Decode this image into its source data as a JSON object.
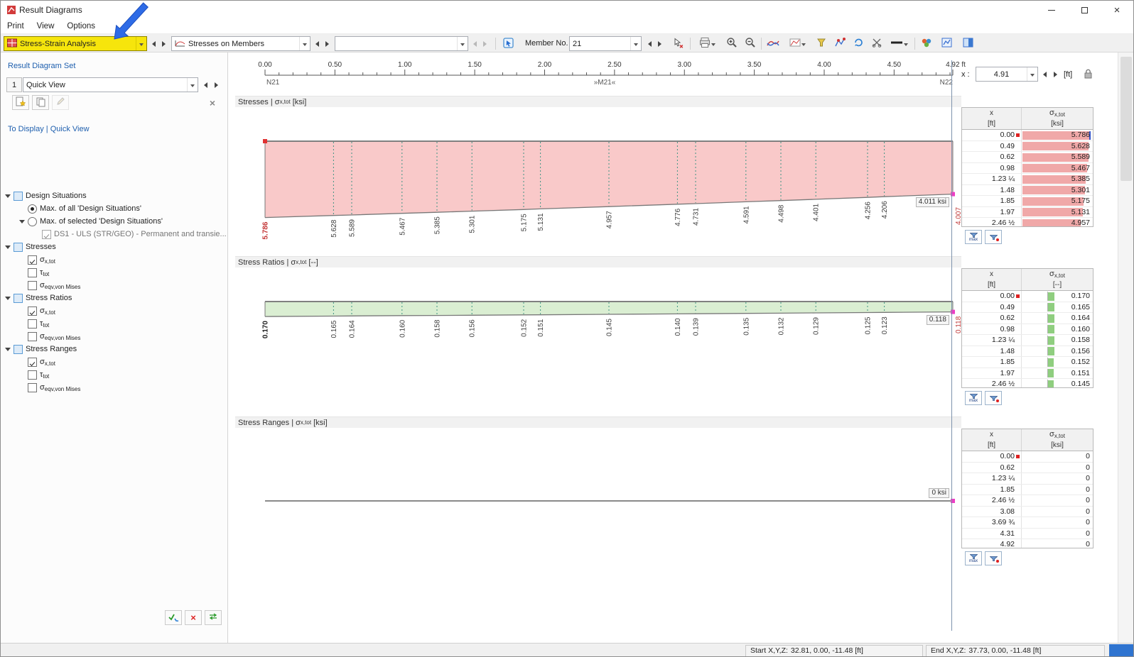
{
  "window": {
    "title": "Result Diagrams"
  },
  "menu": {
    "items": [
      "Print",
      "View",
      "Options"
    ]
  },
  "toolbar": {
    "analysis_combo": "Stress-Strain Analysis",
    "results_combo": "Stresses on Members",
    "empty_combo": "",
    "member_label": "Member No.",
    "member_value": "21"
  },
  "sidebar": {
    "set_section_title": "Result Diagram Set",
    "set_number": "1",
    "set_name": "Quick View",
    "display_section_title": "To Display | Quick View",
    "tree": [
      {
        "level": 0,
        "arrow": true,
        "control": "checkbox",
        "state": "parent",
        "text": "Design Situations"
      },
      {
        "level": 1,
        "arrow": false,
        "control": "radio",
        "state": "selected",
        "text": "Max. of all 'Design Situations'"
      },
      {
        "level": 1,
        "arrow": true,
        "control": "radio",
        "state": "unselected",
        "text": "Max. of selected 'Design Situations'"
      },
      {
        "level": 2,
        "arrow": false,
        "control": "checkbox",
        "state": "checked-disabled",
        "text": "DS1 - ULS (STR/GEO) - Permanent and transie..."
      },
      {
        "level": 0,
        "arrow": true,
        "control": "checkbox",
        "state": "parent",
        "text": "Stresses"
      },
      {
        "level": 1,
        "arrow": false,
        "control": "checkbox",
        "state": "checked",
        "symbol": "σ",
        "sub": "x,tot"
      },
      {
        "level": 1,
        "arrow": false,
        "control": "checkbox",
        "state": "unchecked",
        "symbol": "τ",
        "sub": "tot"
      },
      {
        "level": 1,
        "arrow": false,
        "control": "checkbox",
        "state": "unchecked",
        "symbol": "σ",
        "sub": "eqv,von Mises"
      },
      {
        "level": 0,
        "arrow": true,
        "control": "checkbox",
        "state": "parent",
        "text": "Stress Ratios"
      },
      {
        "level": 1,
        "arrow": false,
        "control": "checkbox",
        "state": "checked",
        "symbol": "σ",
        "sub": "x,tot"
      },
      {
        "level": 1,
        "arrow": false,
        "control": "checkbox",
        "state": "unchecked",
        "symbol": "τ",
        "sub": "tot"
      },
      {
        "level": 1,
        "arrow": false,
        "control": "checkbox",
        "state": "unchecked",
        "symbol": "σ",
        "sub": "eqv,von Mises"
      },
      {
        "level": 0,
        "arrow": true,
        "control": "checkbox",
        "state": "parent",
        "text": "Stress Ranges"
      },
      {
        "level": 1,
        "arrow": false,
        "control": "checkbox",
        "state": "checked",
        "symbol": "σ",
        "sub": "x,tot"
      },
      {
        "level": 1,
        "arrow": false,
        "control": "checkbox",
        "state": "unchecked",
        "symbol": "τ",
        "sub": "tot"
      },
      {
        "level": 1,
        "arrow": false,
        "control": "checkbox",
        "state": "unchecked",
        "symbol": "σ",
        "sub": "eqv,von Mises"
      }
    ]
  },
  "ruler": {
    "major_labels": [
      "0.00",
      "0.50",
      "1.00",
      "1.50",
      "2.00",
      "2.50",
      "3.00",
      "3.50",
      "4.00",
      "4.50"
    ],
    "major_positions_ft": [
      0,
      0.5,
      1,
      1.5,
      2,
      2.5,
      3,
      3.5,
      4,
      4.5
    ],
    "end_label": "4.92 ft",
    "length_ft": 4.92,
    "start_node": "N21",
    "member_label": "»M21«",
    "end_node": "N22"
  },
  "x_control": {
    "label": "x :",
    "value": "4.91",
    "unit": "[ft]"
  },
  "chart_data": [
    {
      "type": "area",
      "title_prefix": "Stresses | ",
      "symbol": "σ",
      "symbol_sub": "x,tot",
      "unit_suffix": " [ksi]",
      "xlim": [
        0,
        4.92
      ],
      "x": [
        0.0,
        0.49,
        0.62,
        0.98,
        1.23,
        1.48,
        1.85,
        1.97,
        2.46,
        2.95,
        3.08,
        3.44,
        3.69,
        3.94,
        4.31,
        4.43,
        4.92
      ],
      "values": [
        5.786,
        5.628,
        5.589,
        5.467,
        5.385,
        5.301,
        5.175,
        5.131,
        4.957,
        4.776,
        4.731,
        4.591,
        4.498,
        4.401,
        4.256,
        4.206,
        4.011
      ],
      "end_label": "4.011 ksi",
      "marker_readout": "4.007",
      "fill": "#f9c9c9",
      "first_label_color": "#c33434"
    },
    {
      "type": "area",
      "title_prefix": "Stress Ratios | ",
      "symbol": "σ",
      "symbol_sub": "x,tot",
      "unit_suffix": " [--]",
      "xlim": [
        0,
        4.92
      ],
      "x": [
        0.0,
        0.49,
        0.62,
        0.98,
        1.23,
        1.48,
        1.85,
        1.97,
        2.46,
        2.95,
        3.08,
        3.44,
        3.69,
        3.94,
        4.31,
        4.43,
        4.92
      ],
      "values": [
        0.17,
        0.165,
        0.164,
        0.16,
        0.158,
        0.156,
        0.152,
        0.151,
        0.145,
        0.14,
        0.139,
        0.135,
        0.132,
        0.129,
        0.125,
        0.123,
        0.118
      ],
      "end_label": "0.118",
      "marker_readout": "0.118",
      "fill": "#daeed2",
      "first_label_color": "#222222"
    },
    {
      "type": "line",
      "title_prefix": "Stress Ranges | ",
      "symbol": "σ",
      "symbol_sub": "x,tot",
      "unit_suffix": " [ksi]",
      "xlim": [
        0,
        4.92
      ],
      "x": [
        0,
        4.92
      ],
      "values": [
        0,
        0
      ],
      "end_label": "0 ksi"
    }
  ],
  "tables": [
    {
      "headers": {
        "col1": "x",
        "col1_unit": "[ft]",
        "col2_symbol": "σ",
        "col2_sub": "x,tot",
        "col2_unit": "[ksi]"
      },
      "bar_mode": "fill",
      "bar_color": "#f0a8a8",
      "bar_scale_max": 5.786,
      "rows": [
        {
          "x": "0.00",
          "value": "5.786",
          "bar": 5.786,
          "max_marker": true,
          "end_cap": true
        },
        {
          "x": "0.49",
          "value": "5.628",
          "bar": 5.628
        },
        {
          "x": "0.62",
          "value": "5.589",
          "bar": 5.589
        },
        {
          "x": "0.98",
          "value": "5.467",
          "bar": 5.467
        },
        {
          "x": "1.23 ¼",
          "value": "5.385",
          "bar": 5.385
        },
        {
          "x": "1.48",
          "value": "5.301",
          "bar": 5.301
        },
        {
          "x": "1.85",
          "value": "5.175",
          "bar": 5.175
        },
        {
          "x": "1.97",
          "value": "5.131",
          "bar": 5.131
        },
        {
          "x": "2.46 ½",
          "value": "4.957",
          "bar": 4.957
        }
      ]
    },
    {
      "headers": {
        "col1": "x",
        "col1_unit": "[ft]",
        "col2_symbol": "σ",
        "col2_sub": "x,tot",
        "col2_unit": "[--]"
      },
      "bar_mode": "axis",
      "bar_color": "#8fce7f",
      "axis_scale": 55,
      "rows": [
        {
          "x": "0.00",
          "value": "0.170",
          "bar": 0.17,
          "max_marker": true
        },
        {
          "x": "0.49",
          "value": "0.165",
          "bar": 0.165
        },
        {
          "x": "0.62",
          "value": "0.164",
          "bar": 0.164
        },
        {
          "x": "0.98",
          "value": "0.160",
          "bar": 0.16
        },
        {
          "x": "1.23 ¼",
          "value": "0.158",
          "bar": 0.158
        },
        {
          "x": "1.48",
          "value": "0.156",
          "bar": 0.156
        },
        {
          "x": "1.85",
          "value": "0.152",
          "bar": 0.152
        },
        {
          "x": "1.97",
          "value": "0.151",
          "bar": 0.151
        },
        {
          "x": "2.46 ½",
          "value": "0.145",
          "bar": 0.145
        }
      ]
    },
    {
      "headers": {
        "col1": "x",
        "col1_unit": "[ft]",
        "col2_symbol": "σ",
        "col2_sub": "x,tot",
        "col2_unit": "[ksi]"
      },
      "bar_mode": "none",
      "rows": [
        {
          "x": "0.00",
          "value": "0",
          "max_marker": true
        },
        {
          "x": "0.62",
          "value": "0"
        },
        {
          "x": "1.23 ¼",
          "value": "0"
        },
        {
          "x": "1.85",
          "value": "0"
        },
        {
          "x": "2.46 ½",
          "value": "0"
        },
        {
          "x": "3.08",
          "value": "0"
        },
        {
          "x": "3.69 ¾",
          "value": "0"
        },
        {
          "x": "4.31",
          "value": "0"
        },
        {
          "x": "4.92",
          "value": "0"
        }
      ]
    }
  ],
  "table_buttons": {
    "max_label": "max"
  },
  "status_bar": {
    "start_label": "Start X,Y,Z:",
    "start_value": "32.81, 0.00, -11.48 [ft]",
    "end_label": "End X,Y,Z:",
    "end_value": "37.73, 0.00, -11.48 [ft]"
  },
  "icons": {
    "app": "result-diagrams-app-icon",
    "analysis_combo": "stress-strain-analysis-icon",
    "results_combo": "member-diagram-icon",
    "pick": "pick-member-icon",
    "deselect": "deselect-icon",
    "print": "printer-icon",
    "zoom_in": "zoom-in-icon",
    "zoom_out": "zoom-out-icon",
    "smooth": "smoothed-diagram-icon",
    "display_mode": "diagram-display-mode-icon",
    "filter": "result-filter-icon",
    "extremes": "extreme-values-icon",
    "refresh": "recalculate-icon",
    "clip": "clipping-icon",
    "line_style": "line-thickness-icon",
    "props": "display-properties-icon",
    "navigator": "result-navigator-icon",
    "dock": "dock-panel-icon",
    "lock": "lock-icon",
    "max_filter": "filter-max-icon",
    "value_filter": "filter-values-icon"
  }
}
